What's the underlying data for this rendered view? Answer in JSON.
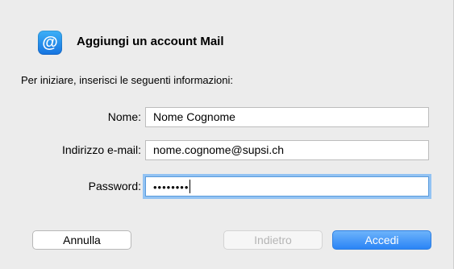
{
  "dialog": {
    "title": "Aggiungi un account Mail",
    "icon": "mail-at-icon",
    "icon_glyph": "@",
    "intro": "Per iniziare, inserisci le seguenti informazioni:"
  },
  "form": {
    "name_label": "Nome:",
    "name_value": "Nome Cognome",
    "email_label": "Indirizzo e-mail:",
    "email_value": "nome.cognome@supsi.ch",
    "password_label": "Password:",
    "password_masked": "••••••••"
  },
  "buttons": {
    "cancel": "Annulla",
    "back": "Indietro",
    "login": "Accedi"
  },
  "colors": {
    "accent": "#2a84f6",
    "focus_ring": "#93c3f3"
  }
}
